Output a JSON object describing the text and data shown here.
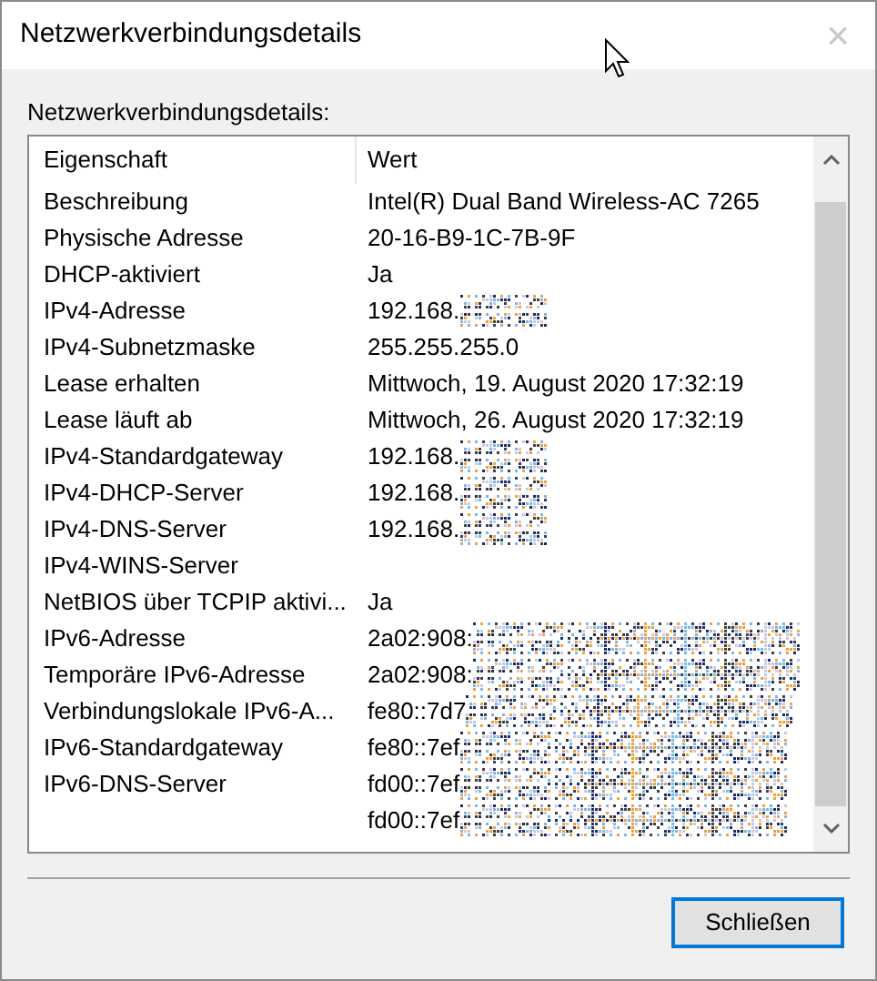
{
  "window": {
    "title": "Netzwerkverbindungsdetails",
    "close": "×"
  },
  "label": "Netzwerkverbindungsdetails:",
  "table": {
    "columns": [
      "Eigenschaft",
      "Wert"
    ],
    "rows": [
      {
        "kind": "plain",
        "property": "Beschreibung",
        "value": "Intel(R) Dual Band Wireless-AC 7265"
      },
      {
        "kind": "plain",
        "property": "Physische Adresse",
        "value": "20-16-B9-1C-7B-9F"
      },
      {
        "kind": "plain",
        "property": "DHCP-aktiviert",
        "value": "Ja"
      },
      {
        "kind": "masked",
        "property": "IPv4-Adresse",
        "value": "192.168."
      },
      {
        "kind": "plain",
        "property": "IPv4-Subnetzmaske",
        "value": "255.255.255.0"
      },
      {
        "kind": "plain",
        "property": "Lease erhalten",
        "value": "Mittwoch, 19. August 2020 17:32:19"
      },
      {
        "kind": "plain",
        "property": "Lease läuft ab",
        "value": "Mittwoch, 26. August 2020 17:32:19"
      },
      {
        "kind": "masked",
        "property": "IPv4-Standardgateway",
        "value": "192.168."
      },
      {
        "kind": "masked",
        "property": "IPv4-DHCP-Server",
        "value": "192.168."
      },
      {
        "kind": "masked",
        "property": "IPv4-DNS-Server",
        "value": "192.168."
      },
      {
        "kind": "plain",
        "property": "IPv4-WINS-Server",
        "value": ""
      },
      {
        "kind": "plain",
        "property": "NetBIOS über TCPIP aktivi...",
        "value": "Ja"
      },
      {
        "kind": "masked-wide",
        "property": "IPv6-Adresse",
        "value": "2a02:908:"
      },
      {
        "kind": "masked-wide",
        "property": "Temporäre IPv6-Adresse",
        "value": "2a02:908:"
      },
      {
        "kind": "masked-wide",
        "property": "Verbindungslokale IPv6-A...",
        "value": "fe80::7d7"
      },
      {
        "kind": "masked-wide",
        "property": "IPv6-Standardgateway",
        "value": "fe80::7ef"
      },
      {
        "kind": "masked-wide",
        "property": "IPv6-DNS-Server",
        "value": "fd00::7ef"
      },
      {
        "kind": "masked-wide",
        "property": "",
        "value": "fd00::7ef"
      }
    ]
  },
  "buttons": [
    "Schließen"
  ]
}
